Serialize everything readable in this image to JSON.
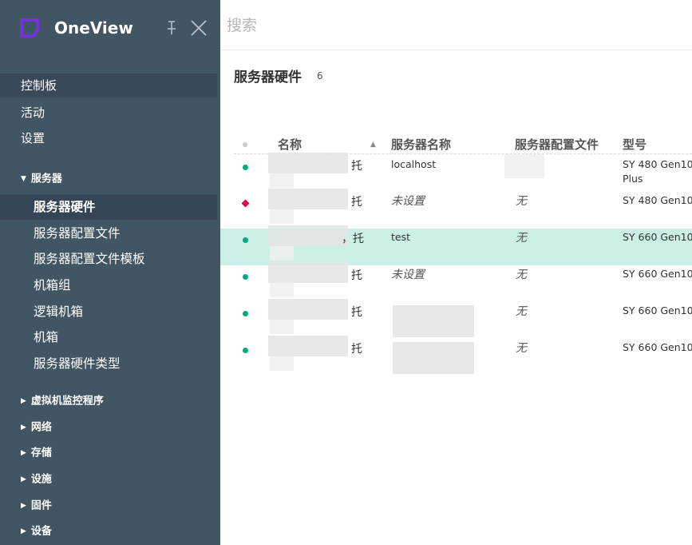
{
  "app": {
    "name": "OneView"
  },
  "search": {
    "placeholder": "搜索"
  },
  "sidebar": {
    "top_items": [
      "控制板",
      "活动",
      "设置"
    ],
    "servers_group": "服务器",
    "server_items": [
      "服务器硬件",
      "服务器配置文件",
      "服务器配置文件模板",
      "机箱组",
      "逻辑机箱",
      "机箱",
      "服务器硬件类型"
    ],
    "active_item": "服务器硬件",
    "collapsed_groups": [
      "虚拟机监控程序",
      "网络",
      "存储",
      "设施",
      "固件",
      "设备"
    ]
  },
  "page": {
    "title": "服务器硬件",
    "count": "6"
  },
  "table": {
    "headers": {
      "name": "名称",
      "server_name": "服务器名称",
      "profile": "服务器配置文件",
      "model": "型号"
    },
    "sort": "ascending-name",
    "rows": [
      {
        "status": "ok",
        "name_suffix": "托",
        "server_name": "localhost",
        "server_name_italic": false,
        "profile": "",
        "model": "SY 480 Gen10",
        "model_line2": "Plus",
        "selected": false
      },
      {
        "status": "warning",
        "name_suffix": "托",
        "server_name": "未设置",
        "server_name_italic": true,
        "profile": "无",
        "model": "SY 480 Gen10",
        "model_line2": "",
        "selected": false
      },
      {
        "status": "ok",
        "name_suffix": "，托",
        "server_name": "test",
        "server_name_italic": false,
        "profile": "无",
        "model": "SY 660 Gen10",
        "model_line2": "",
        "selected": true
      },
      {
        "status": "ok",
        "name_suffix": "托",
        "server_name": "未设置",
        "server_name_italic": true,
        "profile": "无",
        "model": "SY 660 Gen10",
        "model_line2": "",
        "selected": false
      },
      {
        "status": "ok",
        "name_suffix": "托",
        "server_name": "",
        "server_name_italic": false,
        "profile": "无",
        "model": "SY 660 Gen10",
        "model_line2": "",
        "selected": false
      },
      {
        "status": "ok",
        "name_suffix": "托",
        "server_name": "",
        "server_name_italic": false,
        "profile": "无",
        "model": "SY 660 Gen10",
        "model_line2": "",
        "selected": false
      }
    ]
  },
  "colors": {
    "sidebar": "#425563",
    "brand_logo": "#7630ea",
    "status_ok": "#01a982",
    "status_warning": "#e5004c",
    "selected_row": "#cbeee6"
  },
  "icons": {
    "logo": "oneview-logo-icon",
    "pin": "pin-icon",
    "close": "close-icon",
    "sort": "sort-asc-icon"
  }
}
